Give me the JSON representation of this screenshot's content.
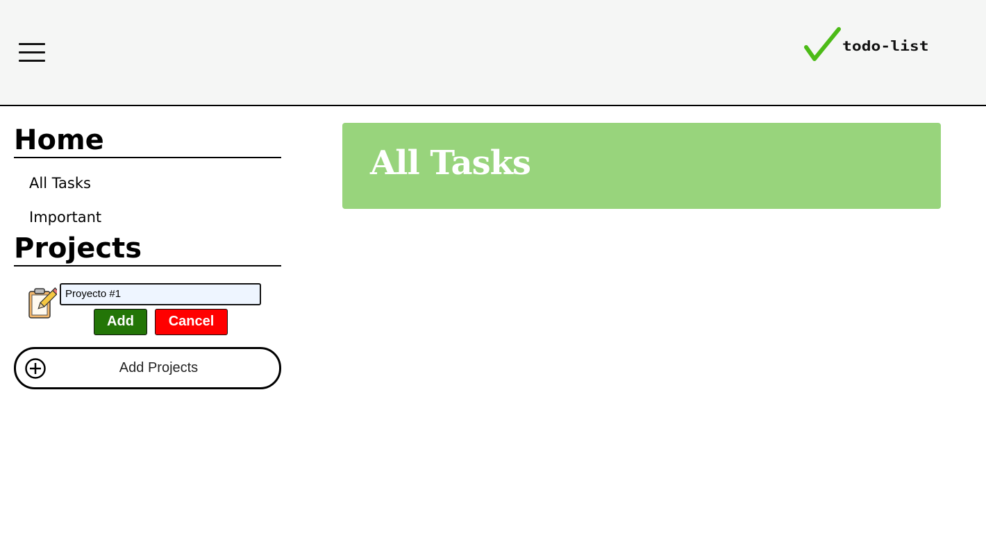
{
  "header": {
    "menu_icon": "hamburger-menu-icon",
    "logo_icon": "checkmark-icon",
    "logo_text": "todo-list",
    "colors": {
      "background": "#f5f6f5",
      "check": "#4cbb17"
    }
  },
  "sidebar": {
    "home_title": "Home",
    "home_items": [
      {
        "label": "All Tasks"
      },
      {
        "label": "Important"
      }
    ],
    "projects_title": "Projects",
    "project_form": {
      "icon": "clipboard-pencil-icon",
      "input_value": "Proyecto #1",
      "add_label": "Add",
      "cancel_label": "Cancel",
      "colors": {
        "add": "#237507",
        "cancel": "#ff0000"
      }
    },
    "add_projects": {
      "icon": "plus-circle-icon",
      "label": "Add Projects"
    }
  },
  "main": {
    "title": "All Tasks",
    "colors": {
      "banner": "#98d47c"
    }
  }
}
